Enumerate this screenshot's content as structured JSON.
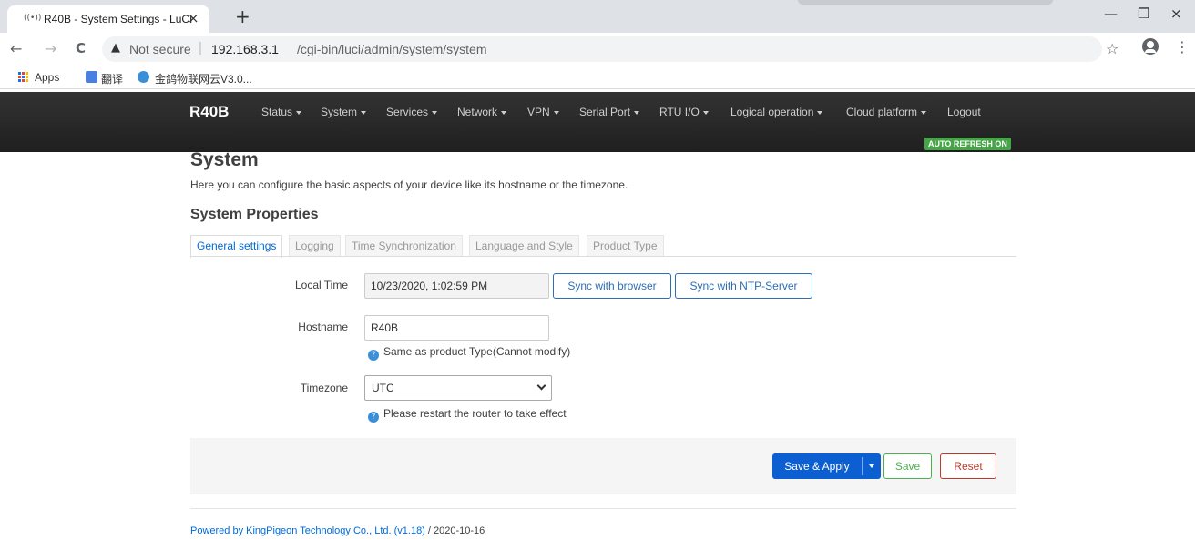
{
  "browser": {
    "tab": {
      "title": "R40B - System Settings - LuCI",
      "favicon": "wireless-icon",
      "close": "×"
    },
    "new_tab": "+",
    "window_buttons": {
      "minimize": "—",
      "restore": "❐",
      "close": "×"
    },
    "nav": {
      "back": "←",
      "forward": "→",
      "reload": "C"
    },
    "address": {
      "warning": "▲",
      "security": "Not secure",
      "separator": "|",
      "host": "192.168.3.1",
      "path": "/cgi-bin/luci/admin/system/system"
    },
    "star": "☆",
    "menu": "⋮",
    "bookmarks": [
      {
        "label": "Apps",
        "icon": "apps-grid-icon"
      },
      {
        "label": "翻译",
        "icon": "translate-icon"
      },
      {
        "label": "金鸽物联网云V3.0...",
        "icon": "cloud-icon"
      }
    ]
  },
  "header": {
    "brand": "R40B",
    "menu": [
      {
        "label": "Status",
        "dropdown": true
      },
      {
        "label": "System",
        "dropdown": true
      },
      {
        "label": "Services",
        "dropdown": true
      },
      {
        "label": "Network",
        "dropdown": true
      },
      {
        "label": "VPN",
        "dropdown": true
      },
      {
        "label": "Serial Port",
        "dropdown": true
      },
      {
        "label": "RTU I/O",
        "dropdown": true
      },
      {
        "label": "Logical operation",
        "dropdown": true
      },
      {
        "label": "Cloud platform",
        "dropdown": true
      },
      {
        "label": "Logout",
        "dropdown": false
      }
    ],
    "auto_refresh": "AUTO REFRESH ON",
    "auto_refresh_color": "#46a546"
  },
  "page": {
    "title": "System",
    "description": "Here you can configure the basic aspects of your device like its hostname or the timezone.",
    "section_title": "System Properties",
    "tabs": [
      {
        "label": "General settings",
        "active": true
      },
      {
        "label": "Logging",
        "active": false
      },
      {
        "label": "Time Synchronization",
        "active": false
      },
      {
        "label": "Language and Style",
        "active": false
      },
      {
        "label": "Product Type",
        "active": false
      }
    ],
    "fields": {
      "local_time": {
        "label": "Local Time",
        "value": "10/23/2020, 1:02:59 PM",
        "sync_browser": "Sync with browser",
        "sync_ntp": "Sync with NTP-Server"
      },
      "hostname": {
        "label": "Hostname",
        "value": "R40B",
        "hint": "Same as product Type(Cannot modify)"
      },
      "timezone": {
        "label": "Timezone",
        "value": "UTC",
        "hint": "Please restart the router to take effect"
      }
    },
    "hint_icon": "?",
    "actions": {
      "save_apply": "Save & Apply",
      "save": "Save",
      "reset": "Reset"
    },
    "accent_color": "#0b5fd1"
  },
  "footer": {
    "link": "Powered by KingPigeon Technology Co., Ltd. (v1.18)",
    "suffix": " / 2020-10-16"
  }
}
